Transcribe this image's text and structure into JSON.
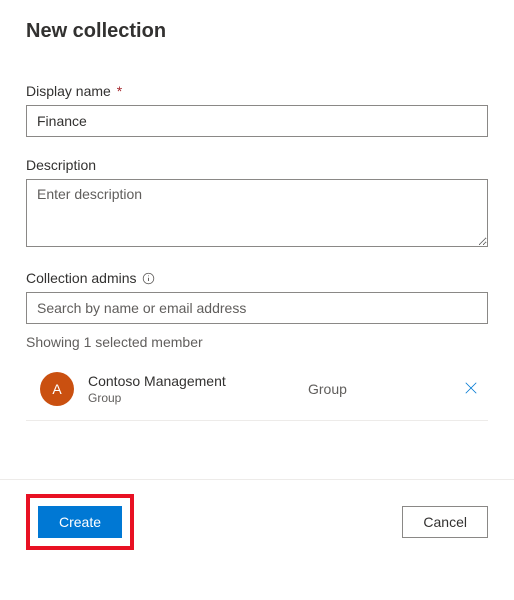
{
  "page_title": "New collection",
  "display_name": {
    "label": "Display name",
    "required_marker": "*",
    "value": "Finance"
  },
  "description": {
    "label": "Description",
    "placeholder": "Enter description",
    "value": ""
  },
  "collection_admins": {
    "label": "Collection admins",
    "placeholder": "Search by name or email address",
    "value": "",
    "selected_text": "Showing 1 selected member",
    "members": [
      {
        "initial": "A",
        "name": "Contoso Management",
        "subtype": "Group",
        "type": "Group"
      }
    ]
  },
  "actions": {
    "create": "Create",
    "cancel": "Cancel"
  }
}
